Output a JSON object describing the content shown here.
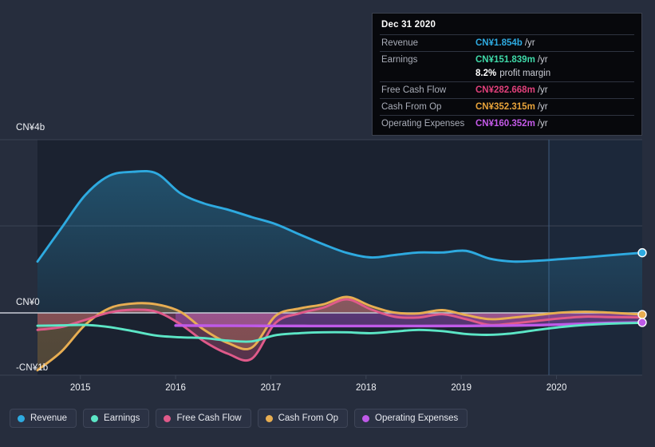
{
  "chart_data": {
    "type": "area",
    "title": "",
    "xlabel": "",
    "ylabel": "CN¥",
    "currency": "CN¥",
    "x_tick_labels": [
      "2015",
      "2016",
      "2017",
      "2018",
      "2019",
      "2020"
    ],
    "y_tick_labels": [
      "CN¥4b",
      "CN¥0",
      "-CN¥1b"
    ],
    "ylim": [
      -1.0,
      4.6
    ],
    "gridlines": [
      "CN¥4b",
      "CN¥2b",
      "CN¥0"
    ],
    "grid": true,
    "legend_position": "bottom-left",
    "zero_line": true,
    "forecast_divider_x_label": "2020",
    "series": [
      {
        "name": "Revenue",
        "color": "#2eaae0",
        "unit": "b",
        "x": [
          2014.55,
          2014.8,
          2015.05,
          2015.3,
          2015.55,
          2015.8,
          2016.05,
          2016.3,
          2016.55,
          2016.8,
          2017.05,
          2017.3,
          2017.55,
          2017.8,
          2018.05,
          2018.3,
          2018.55,
          2018.8,
          2019.05,
          2019.3,
          2019.55,
          2019.8,
          2020.05,
          2020.3,
          2020.55,
          2020.9
        ],
        "values": [
          1.64,
          2.45,
          3.25,
          3.72,
          3.82,
          3.78,
          3.3,
          3.05,
          2.9,
          2.72,
          2.55,
          2.3,
          2.06,
          1.85,
          1.74,
          1.8,
          1.86,
          1.86,
          1.9,
          1.71,
          1.64,
          1.66,
          1.7,
          1.74,
          1.79,
          1.854
        ]
      },
      {
        "name": "Earnings",
        "color": "#5ce6c6",
        "unit": "m",
        "x": [
          2014.55,
          2014.8,
          2015.05,
          2015.3,
          2015.55,
          2015.8,
          2016.05,
          2016.3,
          2016.55,
          2016.8,
          2017.05,
          2017.3,
          2017.55,
          2017.8,
          2018.05,
          2018.3,
          2018.55,
          2018.8,
          2019.05,
          2019.3,
          2019.55,
          2019.8,
          2020.05,
          2020.3,
          2020.55,
          2020.9
        ],
        "values": [
          0.08,
          0.09,
          0.1,
          0.05,
          -0.05,
          -0.16,
          -0.2,
          -0.22,
          -0.28,
          -0.3,
          -0.15,
          -0.1,
          -0.08,
          -0.08,
          -0.1,
          -0.06,
          -0.02,
          -0.05,
          -0.12,
          -0.14,
          -0.1,
          -0.02,
          0.05,
          0.1,
          0.13,
          0.152
        ]
      },
      {
        "name": "Free Cash Flow",
        "color": "#e05a8a",
        "unit": "m",
        "x": [
          2014.55,
          2014.8,
          2015.05,
          2015.3,
          2015.55,
          2015.8,
          2016.05,
          2016.3,
          2016.55,
          2016.8,
          2017.05,
          2017.3,
          2017.55,
          2017.8,
          2018.05,
          2018.3,
          2018.55,
          2018.8,
          2019.05,
          2019.3,
          2019.55,
          2019.8,
          2020.05,
          2020.3,
          2020.55,
          2020.9
        ],
        "values": [
          -0.02,
          0.05,
          0.22,
          0.4,
          0.47,
          0.42,
          0.12,
          -0.3,
          -0.6,
          -0.72,
          0.15,
          0.38,
          0.52,
          0.72,
          0.48,
          0.3,
          0.28,
          0.36,
          0.24,
          0.1,
          0.14,
          0.2,
          0.26,
          0.3,
          0.29,
          0.283
        ]
      },
      {
        "name": "Cash From Op",
        "color": "#e8ae52",
        "unit": "m",
        "x": [
          2014.55,
          2014.8,
          2015.05,
          2015.3,
          2015.55,
          2015.8,
          2016.05,
          2016.3,
          2016.55,
          2016.8,
          2017.05,
          2017.3,
          2017.55,
          2017.8,
          2018.05,
          2018.3,
          2018.55,
          2018.8,
          2019.05,
          2019.3,
          2019.55,
          2019.8,
          2020.05,
          2020.3,
          2020.55,
          2020.9
        ],
        "values": [
          -1.0,
          -0.55,
          0.1,
          0.5,
          0.62,
          0.6,
          0.42,
          -0.02,
          -0.34,
          -0.45,
          0.32,
          0.5,
          0.6,
          0.78,
          0.56,
          0.4,
          0.38,
          0.46,
          0.34,
          0.24,
          0.28,
          0.34,
          0.4,
          0.42,
          0.4,
          0.352
        ]
      },
      {
        "name": "Operating Expenses",
        "color": "#bf5ae8",
        "unit": "m",
        "x": [
          2016.0,
          2016.3,
          2016.55,
          2016.8,
          2017.05,
          2017.3,
          2017.55,
          2017.8,
          2018.05,
          2018.3,
          2018.55,
          2018.8,
          2019.05,
          2019.3,
          2019.55,
          2019.8,
          2020.05,
          2020.3,
          2020.55,
          2020.9
        ],
        "values": [
          0.085,
          0.082,
          0.08,
          0.078,
          0.076,
          0.075,
          0.074,
          0.074,
          0.073,
          0.073,
          0.074,
          0.075,
          0.077,
          0.08,
          0.085,
          0.095,
          0.11,
          0.13,
          0.148,
          0.1604
        ]
      }
    ]
  },
  "tooltip": {
    "title": "Dec 31 2020",
    "rows": [
      {
        "label": "Revenue",
        "value": "CN¥1.854b",
        "unit": "/yr",
        "color": "#2eaae0"
      },
      {
        "label": "Earnings",
        "value": "CN¥151.839m",
        "unit": "/yr",
        "color": "#3fd9a8"
      },
      {
        "label": "",
        "value": "8.2%",
        "unit": "profit margin",
        "color": "#ffffff",
        "sub": true
      },
      {
        "label": "Free Cash Flow",
        "value": "CN¥282.668m",
        "unit": "/yr",
        "color": "#e0407a"
      },
      {
        "label": "Cash From Op",
        "value": "CN¥352.315m",
        "unit": "/yr",
        "color": "#e8a33a"
      },
      {
        "label": "Operating Expenses",
        "value": "CN¥160.352m",
        "unit": "/yr",
        "color": "#c45ae8"
      }
    ]
  },
  "legend": {
    "items": [
      {
        "label": "Revenue",
        "color": "#2eaae0"
      },
      {
        "label": "Earnings",
        "color": "#5ce6c6"
      },
      {
        "label": "Free Cash Flow",
        "color": "#e05a8a"
      },
      {
        "label": "Cash From Op",
        "color": "#e8ae52"
      },
      {
        "label": "Operating Expenses",
        "color": "#bf5ae8"
      }
    ]
  },
  "axes": {
    "y_labels": [
      {
        "text": "CN¥4b",
        "cls": "ylab-top"
      },
      {
        "text": "CN¥0",
        "cls": "ylab-zero"
      },
      {
        "text": "-CN¥1b",
        "cls": "ylab-neg"
      }
    ],
    "x_labels": [
      "2015",
      "2016",
      "2017",
      "2018",
      "2019",
      "2020"
    ]
  },
  "colors": {
    "background": "#262d3d",
    "plot_background": "#1b2230",
    "grid": "#3b4354",
    "zero_line": "#c8ccd6",
    "forecast_band": "#1d2d44"
  }
}
